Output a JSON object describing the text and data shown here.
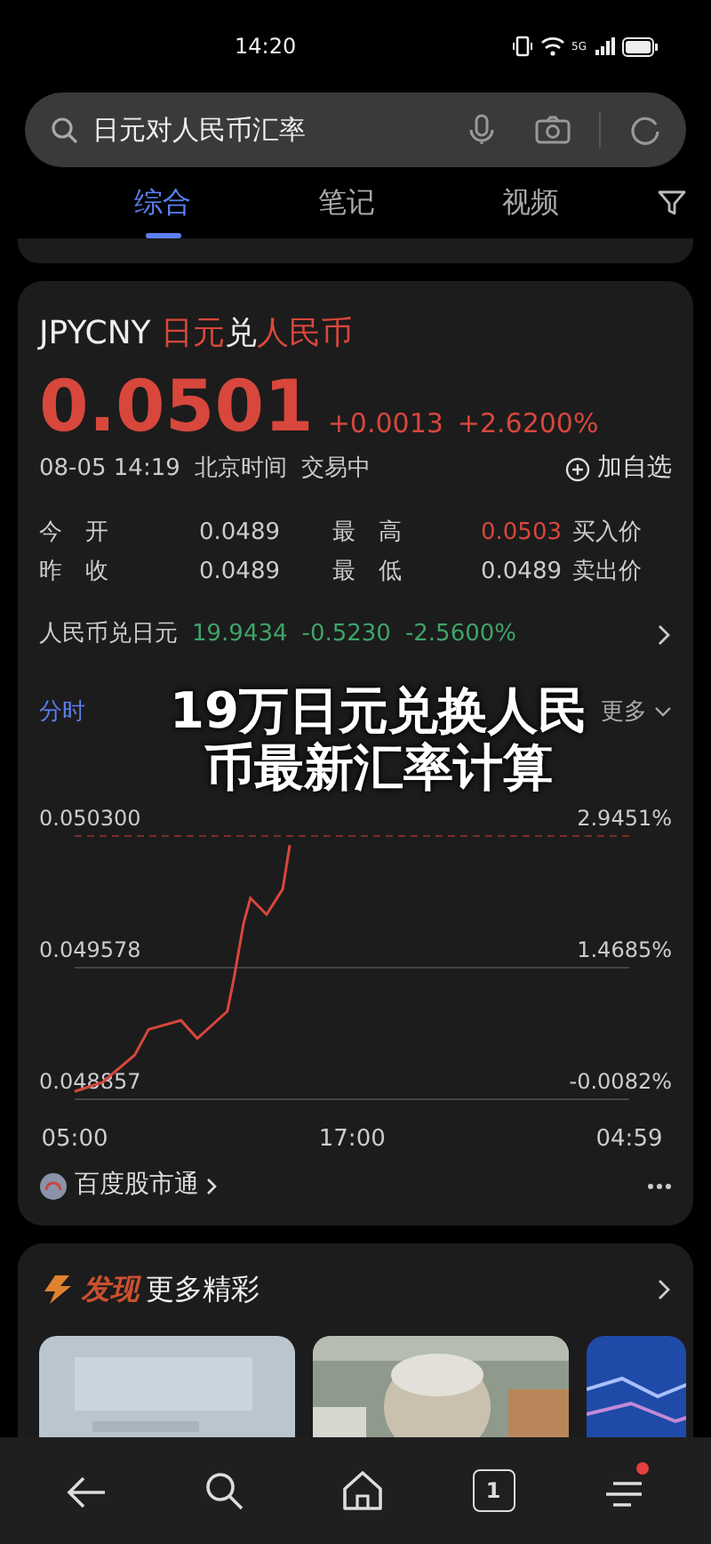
{
  "status_bar": {
    "time": "14:20",
    "signal_label": "5G"
  },
  "search": {
    "value": "日元对人民币汇率"
  },
  "tabs": [
    {
      "label": "综合",
      "selected": true
    },
    {
      "label": "笔记",
      "selected": false
    },
    {
      "label": "视频",
      "selected": false
    }
  ],
  "quote": {
    "symbol": "JPYCNY",
    "name_parts": [
      {
        "text": "日元",
        "accent": true
      },
      {
        "text": "兑",
        "accent": false
      },
      {
        "text": "人民币",
        "accent": true
      }
    ],
    "price": "0.0501",
    "change": "+0.0013",
    "change_pct": "+2.6200%",
    "datetime": "08-05 14:19",
    "timezone": "北京时间",
    "market_state": "交易中",
    "add_watch": "加自选",
    "stats": [
      {
        "label": "今　开",
        "value": "0.0489",
        "label2": "最　高",
        "value2": "0.0503",
        "value2_accent": true,
        "side": "买入价"
      },
      {
        "label": "昨　收",
        "value": "0.0489",
        "label2": "最　低",
        "value2": "0.0489",
        "value2_accent": false,
        "side": "卖出价"
      }
    ],
    "inverse": {
      "label": "人民币兑日元",
      "rate": "19.9434",
      "change": "-0.5230",
      "change_pct": "-2.5600%"
    }
  },
  "chart_tabs": [
    {
      "label": "分时",
      "selected": true
    },
    {
      "label": "更多",
      "selected": false
    }
  ],
  "overlay_title": "19万日元兑换人民币最新汇率计算",
  "chart_data": {
    "type": "line",
    "x": [
      5,
      6.2,
      7.6,
      8.2,
      9.6,
      10.3,
      11.6,
      11.9,
      12.3,
      12.6,
      13.3,
      14,
      14.3
    ],
    "series": [
      {
        "color": "#d8473c",
        "values": [
          0.0489,
          0.04895,
          0.0491,
          0.04924,
          0.04929,
          0.04919,
          0.04934,
          0.04953,
          0.04982,
          0.04996,
          0.04987,
          0.05001,
          0.05025
        ]
      }
    ],
    "xlim": [
      5,
      28.98
    ],
    "ylim": [
      0.048857,
      0.0503
    ],
    "xticks": [
      {
        "value": 5,
        "label": "05:00"
      },
      {
        "value": 17,
        "label": "17:00"
      }
    ],
    "yticks": [
      {
        "value": 0.0503,
        "label": "0.050300"
      },
      {
        "value": 0.049578,
        "label": "0.049578"
      },
      {
        "value": 0.048857,
        "label": "0.048857"
      }
    ],
    "annotations": [
      "2.9451%",
      "1.4685%",
      "-0.0082%"
    ]
  },
  "session_end_time": "04:59",
  "source": "百度股市通",
  "discover": {
    "title_accent": "发现",
    "title": "更多精彩"
  },
  "nav": {
    "tab_count": "1",
    "menu_badge": true
  }
}
